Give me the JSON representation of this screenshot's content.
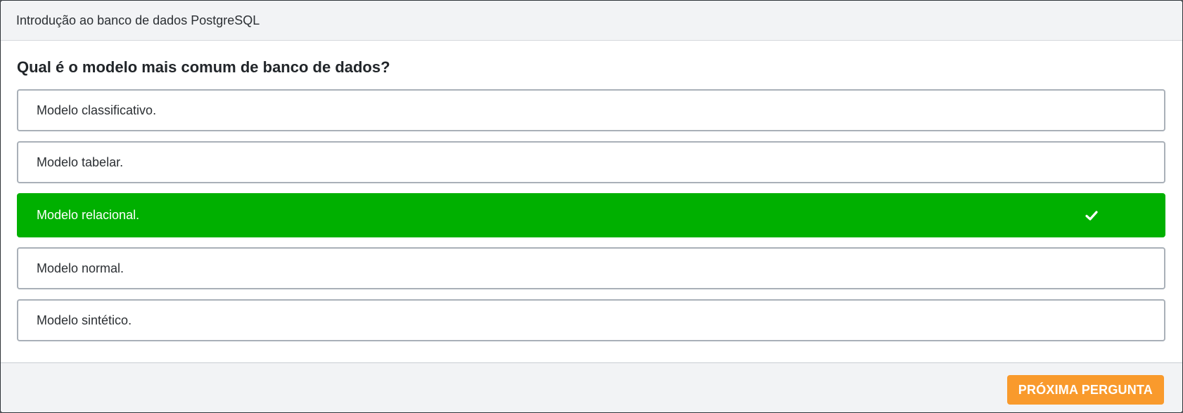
{
  "header": {
    "course_title": "Introdução ao banco de dados PostgreSQL"
  },
  "question": {
    "text": "Qual é o modelo mais comum de banco de dados?"
  },
  "options": [
    {
      "label": "Modelo classificativo.",
      "selected": false
    },
    {
      "label": "Modelo tabelar.",
      "selected": false
    },
    {
      "label": "Modelo relacional.",
      "selected": true,
      "icon": "check-icon"
    },
    {
      "label": "Modelo normal.",
      "selected": false
    },
    {
      "label": "Modelo sintético.",
      "selected": false
    }
  ],
  "footer": {
    "next_label": "PRÓXIMA PERGUNTA"
  },
  "colors": {
    "correct": "#00b000",
    "accent": "#f99a2c",
    "header_bg": "#f2f3f5"
  }
}
